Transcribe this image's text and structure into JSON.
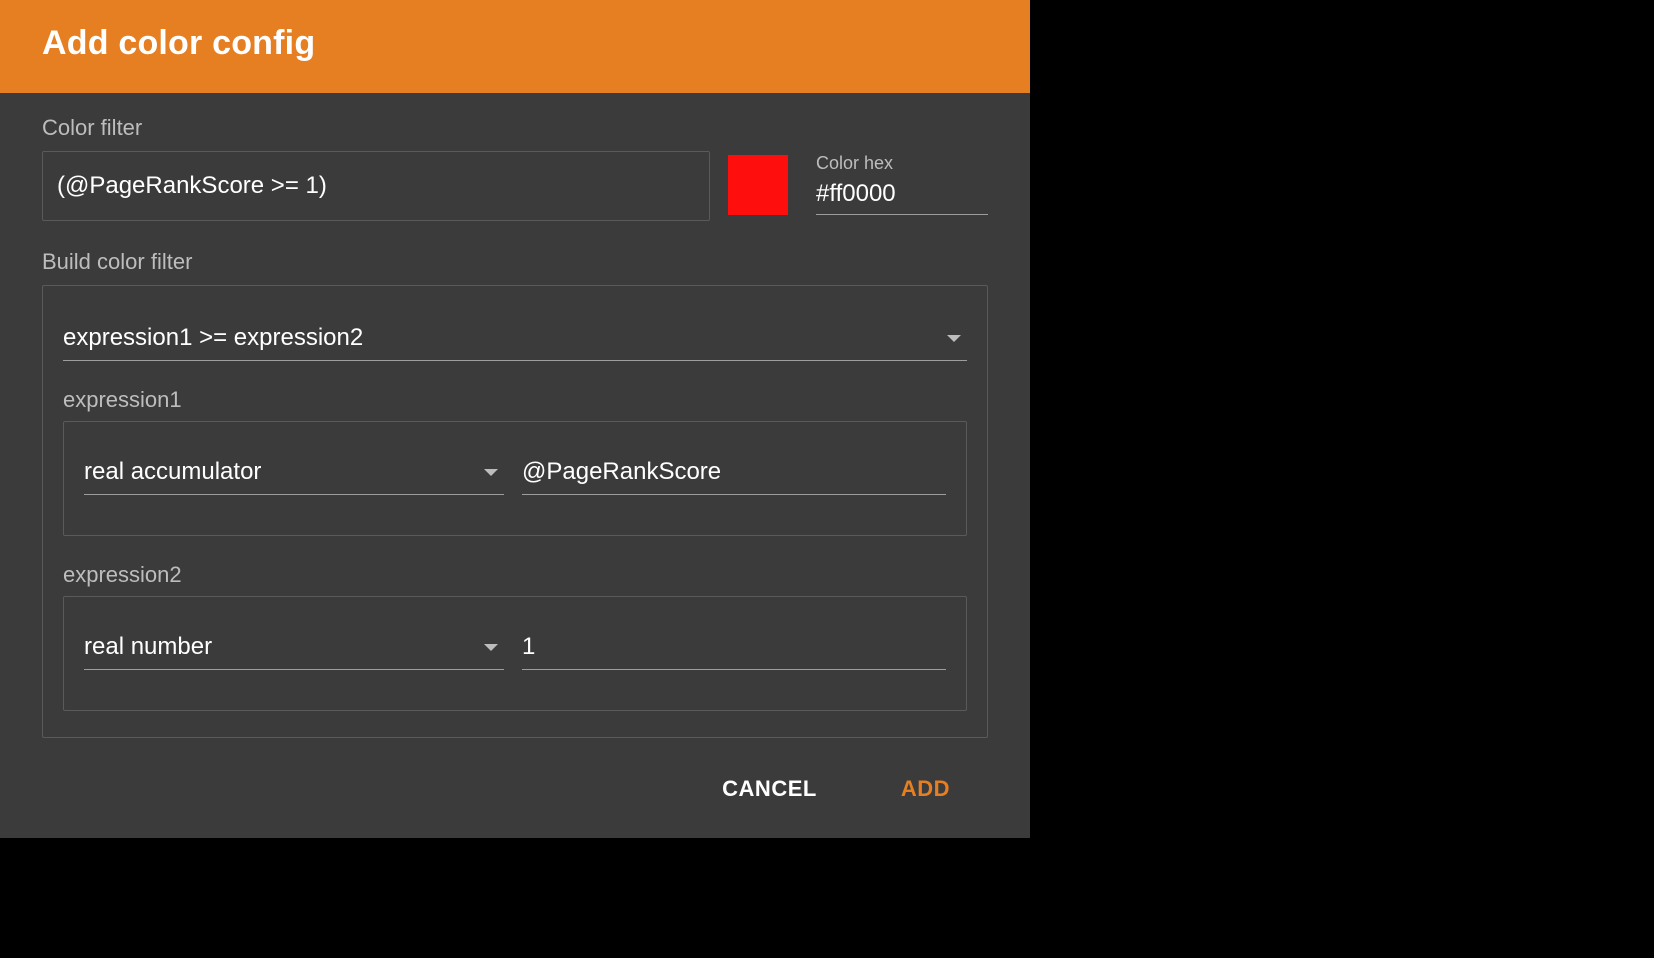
{
  "dialog": {
    "title": "Add color config",
    "colorFilter": {
      "label": "Color filter",
      "value": "(@PageRankScore >= 1)"
    },
    "colorSwatchHex": "#ff0e0e",
    "colorHex": {
      "label": "Color hex",
      "value": "#ff0000"
    },
    "builder": {
      "label": "Build color filter",
      "operatorSelect": "expression1 >= expression2",
      "expression1": {
        "label": "expression1",
        "typeSelect": "real accumulator",
        "value": "@PageRankScore"
      },
      "expression2": {
        "label": "expression2",
        "typeSelect": "real number",
        "value": "1"
      }
    },
    "actions": {
      "cancel": "CANCEL",
      "add": "ADD"
    }
  }
}
